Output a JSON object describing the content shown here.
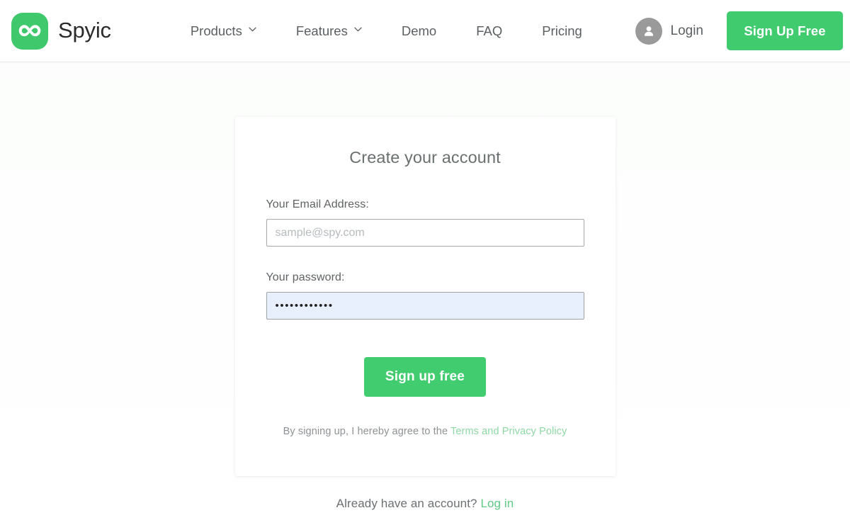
{
  "header": {
    "brand": {
      "name": "Spyic",
      "logo_icon": "infinity-logo-icon",
      "logo_color": "#3fc86c"
    },
    "nav": [
      {
        "label": "Products",
        "has_caret": true
      },
      {
        "label": "Features",
        "has_caret": true
      },
      {
        "label": "Demo",
        "has_caret": false
      },
      {
        "label": "FAQ",
        "has_caret": false
      },
      {
        "label": "Pricing",
        "has_caret": false
      }
    ],
    "login": {
      "label": "Login",
      "avatar_icon": "user-avatar-icon"
    },
    "signup_button": {
      "label": "Sign Up Free",
      "color": "#3fcb6e"
    }
  },
  "card": {
    "title": "Create your account",
    "email": {
      "label": "Your Email Address:",
      "placeholder": "sample@spy.com",
      "value": ""
    },
    "password": {
      "label": "Your password:",
      "placeholder": "",
      "value": "••••••••••••",
      "autofill_color": "#e8f0fd"
    },
    "submit_button": {
      "label": "Sign up free",
      "color": "#41cc6f"
    },
    "terms": {
      "text": "By signing up, I hereby agree to the ",
      "link_label": "Terms and Privacy Policy",
      "link_color": "#8ed9a6"
    }
  },
  "footer": {
    "already_text": "Already have an account? ",
    "login_link_label": "Log in",
    "login_link_color": "#5fca85"
  }
}
